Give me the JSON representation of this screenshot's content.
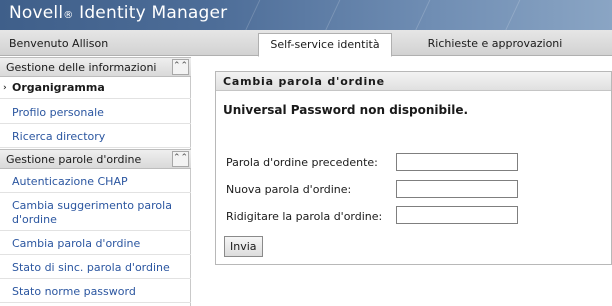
{
  "header": {
    "brand": "Novell",
    "registered": "®",
    "product": " Identity Manager",
    "welcome": "Benvenuto Allison"
  },
  "tabs": [
    {
      "label": "Self-service identità",
      "active": true
    },
    {
      "label": "Richieste e approvazioni",
      "active": false
    }
  ],
  "sidebar": {
    "sections": [
      {
        "title": "Gestione delle informazioni",
        "collapse_icon": "double-chevron-up-icon",
        "items": [
          {
            "label": "Organigramma",
            "current": true
          },
          {
            "label": "Profilo personale"
          },
          {
            "label": "Ricerca directory"
          }
        ]
      },
      {
        "title": "Gestione parole d'ordine",
        "collapse_icon": "double-chevron-up-icon",
        "items": [
          {
            "label": "Autenticazione CHAP"
          },
          {
            "label": "Cambia suggerimento parola d'ordine"
          },
          {
            "label": "Cambia parola d'ordine"
          },
          {
            "label": "Stato di sinc. parola d'ordine"
          },
          {
            "label": "Stato norme password"
          }
        ]
      }
    ]
  },
  "panel": {
    "title": "Cambia parola d'ordine",
    "notice": "Universal Password non disponibile.",
    "fields": [
      {
        "label": "Parola d'ordine precedente:",
        "value": ""
      },
      {
        "label": "Nuova parola d'ordine:",
        "value": ""
      },
      {
        "label": "Ridigitare la parola d'ordine:",
        "value": ""
      }
    ],
    "submit_label": "Invia"
  },
  "colors": {
    "banner": "#4d6d98",
    "link": "#2b56a0"
  }
}
